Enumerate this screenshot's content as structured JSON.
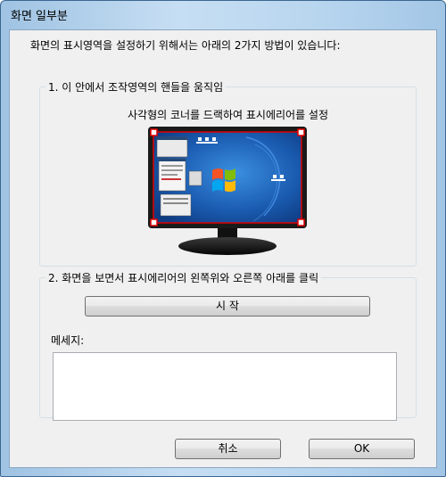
{
  "window": {
    "title": "화면 일부분"
  },
  "intro_text": "화면의 표시영역을 설정하기 위해서는 아래의 2가지 방법이 있습니다:",
  "method1": {
    "legend": "1. 이 안에서 조작영역의 핸들을 움직임",
    "instruction": "사각형의 코너를 드랙하여 표시에리어를 설정"
  },
  "method2": {
    "legend": "2. 화면을 보면서 표시에리어의 왼쪽위와 오른쪽 아래를 클릭",
    "start_label": "시 작",
    "message_label": "메세지:",
    "message_value": ""
  },
  "buttons": {
    "cancel_label": "취소",
    "ok_label": "OK"
  },
  "colors": {
    "selection_handle": "#e00000",
    "desktop_bg": "#1c5fb5"
  }
}
